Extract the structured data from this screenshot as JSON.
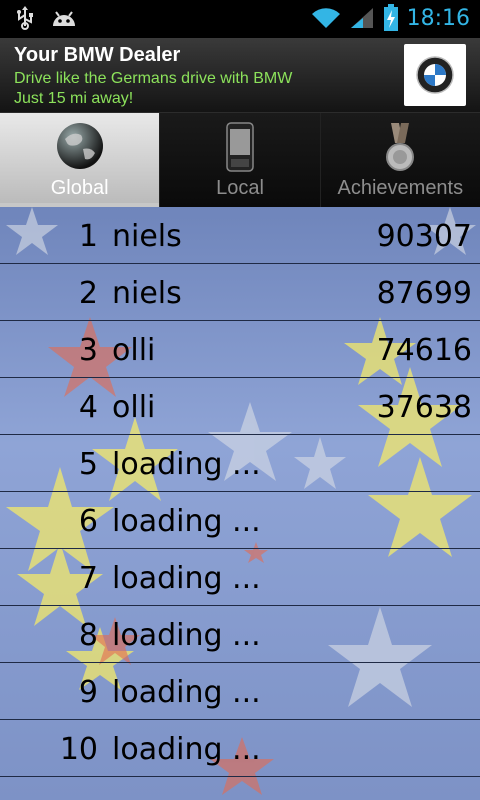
{
  "status_bar": {
    "icons_left": [
      "usb-icon",
      "android-icon"
    ],
    "icons_right": [
      "wifi-icon",
      "signal-icon",
      "battery-charging-icon"
    ],
    "time": "18:16",
    "clock_color": "#33b5e5"
  },
  "ad": {
    "title": "Your BMW Dealer",
    "line1": "Drive like the Germans drive with BMW",
    "line2": "Just 15 mi away!",
    "text_color": "#8ce25b"
  },
  "tabs": [
    {
      "label": "Global",
      "icon": "globe-icon",
      "active": true
    },
    {
      "label": "Local",
      "icon": "phone-icon",
      "active": false
    },
    {
      "label": "Achievements",
      "icon": "medal-icon",
      "active": false
    }
  ],
  "leaderboard": {
    "rows": [
      {
        "rank": "1",
        "name": "niels",
        "score": "90307"
      },
      {
        "rank": "2",
        "name": "niels",
        "score": "87699"
      },
      {
        "rank": "3",
        "name": "olli",
        "score": "74616"
      },
      {
        "rank": "4",
        "name": "olli",
        "score": "37638"
      },
      {
        "rank": "5",
        "name": "loading ...",
        "score": ""
      },
      {
        "rank": "6",
        "name": "loading ...",
        "score": ""
      },
      {
        "rank": "7",
        "name": "loading ...",
        "score": ""
      },
      {
        "rank": "8",
        "name": "loading ...",
        "score": ""
      },
      {
        "rank": "9",
        "name": "loading ...",
        "score": ""
      },
      {
        "rank": "10",
        "name": "loading ...",
        "score": ""
      }
    ]
  }
}
